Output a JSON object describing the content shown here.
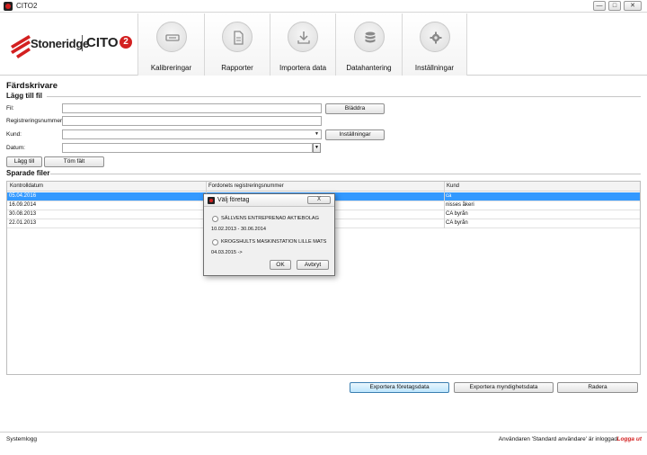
{
  "window": {
    "title": "CITO2",
    "minimize": "—",
    "maximize": "□",
    "close": "✕"
  },
  "header": {
    "brand": "Stoneridge",
    "product": "CITO",
    "product_badge": "2",
    "nav": [
      {
        "label": "Kalibreringar",
        "icon": "calibration-icon"
      },
      {
        "label": "Rapporter",
        "icon": "document-icon"
      },
      {
        "label": "Importera data",
        "icon": "download-icon"
      },
      {
        "label": "Datahantering",
        "icon": "database-icon"
      },
      {
        "label": "Inställningar",
        "icon": "gear-icon"
      }
    ]
  },
  "page": {
    "title": "Färdskrivare",
    "add_section": "Lägg till fil",
    "saved_section": "Sparade filer"
  },
  "form": {
    "file_label": "Fil:",
    "file_value": "",
    "browse_button": "Bläddra",
    "regnr_label": "Registreringsnummer:",
    "regnr_value": "",
    "customer_label": "Kund:",
    "customer_value": "",
    "settings_button": "Inställningar",
    "date_label": "Datum:",
    "date_value": "",
    "add_button": "Lägg till",
    "clear_button": "Töm fält"
  },
  "table": {
    "columns": [
      "Kontrolldatum",
      "Fordonets registreringsnummer",
      "Kund"
    ],
    "rows": [
      {
        "date": "05.04.2016",
        "regnr": "",
        "customer": "ca",
        "selected": true
      },
      {
        "date": "16.09.2014",
        "regnr": "",
        "customer": "nisses åkeri",
        "selected": false
      },
      {
        "date": "30.08.2013",
        "regnr": "",
        "customer": "CA byrån",
        "selected": false
      },
      {
        "date": "22.01.2013",
        "regnr": "",
        "customer": "CA byrån",
        "selected": false
      }
    ]
  },
  "actions": {
    "export_company": "Exportera företagsdata",
    "export_authority": "Exportera myndighetsdata",
    "delete": "Radera"
  },
  "status": {
    "left": "Systemlogg",
    "user_text": "Användaren 'Standard användare' är inloggad",
    "logout": "Logga ut"
  },
  "dialog": {
    "title": "Välj företag",
    "close": "X",
    "options": [
      {
        "name": "SÄLLVENS ENTREPRENAD AKTIEBOLAG",
        "period": "10.02.2013 - 30.06.2014"
      },
      {
        "name": "KROGSHULTS MASKINSTATION LILLE MATS",
        "period": "04.03.2015 ->"
      }
    ],
    "ok": "OK",
    "cancel": "Avbryt"
  },
  "colors": {
    "accent_red": "#d32020",
    "selection_blue": "#3399ff"
  }
}
